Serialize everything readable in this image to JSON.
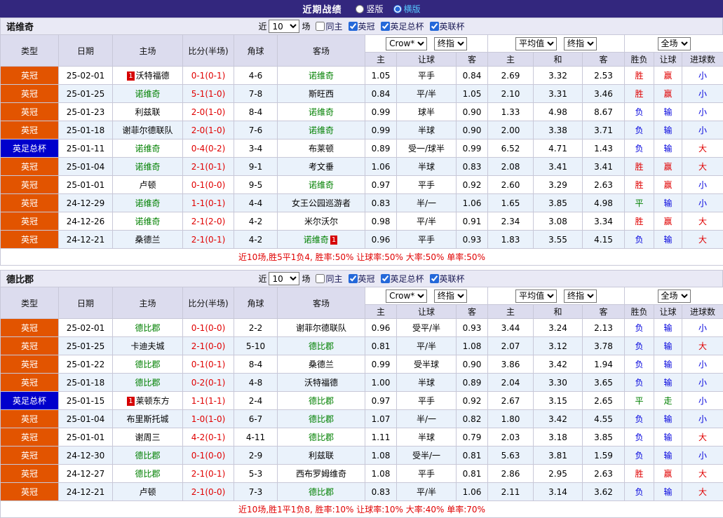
{
  "palette": {
    "topbar_bg": "#33277e",
    "teambar_bg": "#e9e9f5",
    "header_bg": "#dcdcee",
    "row_alt": "#eaf2fb",
    "league_type_bg": "#e25400",
    "cup_type_bg": "#0000cc",
    "team_green": "#008000",
    "score_red": "#e00000",
    "win_red": "#e00000",
    "lose_blue": "#0000dd",
    "draw_green": "#008000",
    "radio_selected": "#56c8ff"
  },
  "top_bar": {
    "title": "近期战绩",
    "options": [
      {
        "label": "竖版",
        "checked": false
      },
      {
        "label": "横版",
        "checked": true
      }
    ]
  },
  "controls": {
    "near": "近",
    "count": "10",
    "matches": "场",
    "same_home": {
      "label": "同主",
      "checked": false
    },
    "leagues": [
      {
        "label": "英冠",
        "checked": true
      },
      {
        "label": "英足总杯",
        "checked": true
      },
      {
        "label": "英联杯",
        "checked": true
      }
    ]
  },
  "selects": {
    "asian_company": "Crow*",
    "asian_time": "终指",
    "euro_company": "平均值",
    "euro_time": "终指",
    "scope": "全场"
  },
  "table_header": {
    "type": "类型",
    "date": "日期",
    "home": "主场",
    "score": "比分(半场)",
    "corner": "角球",
    "away": "客场",
    "asian": [
      "主",
      "让球",
      "客"
    ],
    "euro": [
      "主",
      "和",
      "客"
    ],
    "result": [
      "胜负",
      "让球",
      "进球数"
    ]
  },
  "result_color_map": {
    "胜": "red",
    "平": "green",
    "负": "blue",
    "赢": "red",
    "走": "green",
    "输": "blue",
    "大": "red",
    "小": "blue"
  },
  "sections": [
    {
      "team": "诺维奇",
      "rows": [
        {
          "type": "英冠",
          "cup": false,
          "date": "25-02-01",
          "home": {
            "name": "沃特福德",
            "badge": "1",
            "badge_pos": "before"
          },
          "score": "0-1(0-1)",
          "corner": "4-6",
          "away": {
            "name": "诺维奇",
            "green": true
          },
          "odds": [
            "1.05",
            "平手",
            "0.84",
            "2.69",
            "3.32",
            "2.53"
          ],
          "results": [
            "胜",
            "赢",
            "小"
          ]
        },
        {
          "type": "英冠",
          "cup": false,
          "date": "25-01-25",
          "home": {
            "name": "诺维奇",
            "green": true
          },
          "score": "5-1(1-0)",
          "corner": "7-8",
          "away": {
            "name": "斯旺西"
          },
          "odds": [
            "0.84",
            "平/半",
            "1.05",
            "2.10",
            "3.31",
            "3.46"
          ],
          "results": [
            "胜",
            "赢",
            "小"
          ]
        },
        {
          "type": "英冠",
          "cup": false,
          "date": "25-01-23",
          "home": {
            "name": "利兹联"
          },
          "score": "2-0(1-0)",
          "corner": "8-4",
          "away": {
            "name": "诺维奇",
            "green": true
          },
          "odds": [
            "0.99",
            "球半",
            "0.90",
            "1.33",
            "4.98",
            "8.67"
          ],
          "results": [
            "负",
            "输",
            "小"
          ]
        },
        {
          "type": "英冠",
          "cup": false,
          "date": "25-01-18",
          "home": {
            "name": "谢菲尔德联队"
          },
          "score": "2-0(1-0)",
          "corner": "7-6",
          "away": {
            "name": "诺维奇",
            "green": true
          },
          "odds": [
            "0.99",
            "半球",
            "0.90",
            "2.00",
            "3.38",
            "3.71"
          ],
          "results": [
            "负",
            "输",
            "小"
          ]
        },
        {
          "type": "英足总杯",
          "cup": true,
          "date": "25-01-11",
          "home": {
            "name": "诺维奇",
            "green": true
          },
          "score": "0-4(0-2)",
          "corner": "3-4",
          "away": {
            "name": "布莱顿"
          },
          "odds": [
            "0.89",
            "受一/球半",
            "0.99",
            "6.52",
            "4.71",
            "1.43"
          ],
          "results": [
            "负",
            "输",
            "大"
          ]
        },
        {
          "type": "英冠",
          "cup": false,
          "date": "25-01-04",
          "home": {
            "name": "诺维奇",
            "green": true
          },
          "score": "2-1(0-1)",
          "corner": "9-1",
          "away": {
            "name": "考文垂"
          },
          "odds": [
            "1.06",
            "半球",
            "0.83",
            "2.08",
            "3.41",
            "3.41"
          ],
          "results": [
            "胜",
            "赢",
            "大"
          ]
        },
        {
          "type": "英冠",
          "cup": false,
          "date": "25-01-01",
          "home": {
            "name": "卢顿"
          },
          "score": "0-1(0-0)",
          "corner": "9-5",
          "away": {
            "name": "诺维奇",
            "green": true
          },
          "odds": [
            "0.97",
            "平手",
            "0.92",
            "2.60",
            "3.29",
            "2.63"
          ],
          "results": [
            "胜",
            "赢",
            "小"
          ]
        },
        {
          "type": "英冠",
          "cup": false,
          "date": "24-12-29",
          "home": {
            "name": "诺维奇",
            "green": true
          },
          "score": "1-1(0-1)",
          "corner": "4-4",
          "away": {
            "name": "女王公园巡游者"
          },
          "odds": [
            "0.83",
            "半/一",
            "1.06",
            "1.65",
            "3.85",
            "4.98"
          ],
          "results": [
            "平",
            "输",
            "小"
          ]
        },
        {
          "type": "英冠",
          "cup": false,
          "date": "24-12-26",
          "home": {
            "name": "诺维奇",
            "green": true
          },
          "score": "2-1(2-0)",
          "corner": "4-2",
          "away": {
            "name": "米尔沃尔"
          },
          "odds": [
            "0.98",
            "平/半",
            "0.91",
            "2.34",
            "3.08",
            "3.34"
          ],
          "results": [
            "胜",
            "赢",
            "大"
          ]
        },
        {
          "type": "英冠",
          "cup": false,
          "date": "24-12-21",
          "home": {
            "name": "桑德兰"
          },
          "score": "2-1(0-1)",
          "corner": "4-2",
          "away": {
            "name": "诺维奇",
            "green": true,
            "badge": "1",
            "badge_pos": "after"
          },
          "odds": [
            "0.96",
            "平手",
            "0.93",
            "1.83",
            "3.55",
            "4.15"
          ],
          "results": [
            "负",
            "输",
            "大"
          ]
        }
      ],
      "summary": "近10场,胜5平1负4, 胜率:50% 让球率:50% 大率:50% 单率:50%"
    },
    {
      "team": "德比郡",
      "rows": [
        {
          "type": "英冠",
          "cup": false,
          "date": "25-02-01",
          "home": {
            "name": "德比郡",
            "green": true
          },
          "score": "0-1(0-0)",
          "corner": "2-2",
          "away": {
            "name": "谢菲尔德联队"
          },
          "odds": [
            "0.96",
            "受平/半",
            "0.93",
            "3.44",
            "3.24",
            "2.13"
          ],
          "results": [
            "负",
            "输",
            "小"
          ]
        },
        {
          "type": "英冠",
          "cup": false,
          "date": "25-01-25",
          "home": {
            "name": "卡迪夫城"
          },
          "score": "2-1(0-0)",
          "corner": "5-10",
          "away": {
            "name": "德比郡",
            "green": true
          },
          "odds": [
            "0.81",
            "平/半",
            "1.08",
            "2.07",
            "3.12",
            "3.78"
          ],
          "results": [
            "负",
            "输",
            "大"
          ]
        },
        {
          "type": "英冠",
          "cup": false,
          "date": "25-01-22",
          "home": {
            "name": "德比郡",
            "green": true
          },
          "score": "0-1(0-1)",
          "corner": "8-4",
          "away": {
            "name": "桑德兰"
          },
          "odds": [
            "0.99",
            "受半球",
            "0.90",
            "3.86",
            "3.42",
            "1.94"
          ],
          "results": [
            "负",
            "输",
            "小"
          ]
        },
        {
          "type": "英冠",
          "cup": false,
          "date": "25-01-18",
          "home": {
            "name": "德比郡",
            "green": true
          },
          "score": "0-2(0-1)",
          "corner": "4-8",
          "away": {
            "name": "沃特福德"
          },
          "odds": [
            "1.00",
            "半球",
            "0.89",
            "2.04",
            "3.30",
            "3.65"
          ],
          "results": [
            "负",
            "输",
            "小"
          ]
        },
        {
          "type": "英足总杯",
          "cup": true,
          "date": "25-01-15",
          "home": {
            "name": "莱顿东方",
            "badge": "1",
            "badge_pos": "before"
          },
          "score": "1-1(1-1)",
          "corner": "2-4",
          "away": {
            "name": "德比郡",
            "green": true
          },
          "odds": [
            "0.97",
            "平手",
            "0.92",
            "2.67",
            "3.15",
            "2.65"
          ],
          "results": [
            "平",
            "走",
            "小"
          ]
        },
        {
          "type": "英冠",
          "cup": false,
          "date": "25-01-04",
          "home": {
            "name": "布里斯托城"
          },
          "score": "1-0(1-0)",
          "corner": "6-7",
          "away": {
            "name": "德比郡",
            "green": true
          },
          "odds": [
            "1.07",
            "半/一",
            "0.82",
            "1.80",
            "3.42",
            "4.55"
          ],
          "results": [
            "负",
            "输",
            "小"
          ]
        },
        {
          "type": "英冠",
          "cup": false,
          "date": "25-01-01",
          "home": {
            "name": "谢周三"
          },
          "score": "4-2(0-1)",
          "corner": "4-11",
          "away": {
            "name": "德比郡",
            "green": true
          },
          "odds": [
            "1.11",
            "半球",
            "0.79",
            "2.03",
            "3.18",
            "3.85"
          ],
          "results": [
            "负",
            "输",
            "大"
          ]
        },
        {
          "type": "英冠",
          "cup": false,
          "date": "24-12-30",
          "home": {
            "name": "德比郡",
            "green": true
          },
          "score": "0-1(0-0)",
          "corner": "2-9",
          "away": {
            "name": "利兹联"
          },
          "odds": [
            "1.08",
            "受半/一",
            "0.81",
            "5.63",
            "3.81",
            "1.59"
          ],
          "results": [
            "负",
            "输",
            "小"
          ]
        },
        {
          "type": "英冠",
          "cup": false,
          "date": "24-12-27",
          "home": {
            "name": "德比郡",
            "green": true
          },
          "score": "2-1(0-1)",
          "corner": "5-3",
          "away": {
            "name": "西布罗姆维奇"
          },
          "odds": [
            "1.08",
            "平手",
            "0.81",
            "2.86",
            "2.95",
            "2.63"
          ],
          "results": [
            "胜",
            "赢",
            "大"
          ]
        },
        {
          "type": "英冠",
          "cup": false,
          "date": "24-12-21",
          "home": {
            "name": "卢顿"
          },
          "score": "2-1(0-0)",
          "corner": "7-3",
          "away": {
            "name": "德比郡",
            "green": true
          },
          "odds": [
            "0.83",
            "平/半",
            "1.06",
            "2.11",
            "3.14",
            "3.62"
          ],
          "results": [
            "负",
            "输",
            "大"
          ]
        }
      ],
      "summary": "近10场,胜1平1负8, 胜率:10% 让球率:10% 大率:40% 单率:70%"
    }
  ]
}
